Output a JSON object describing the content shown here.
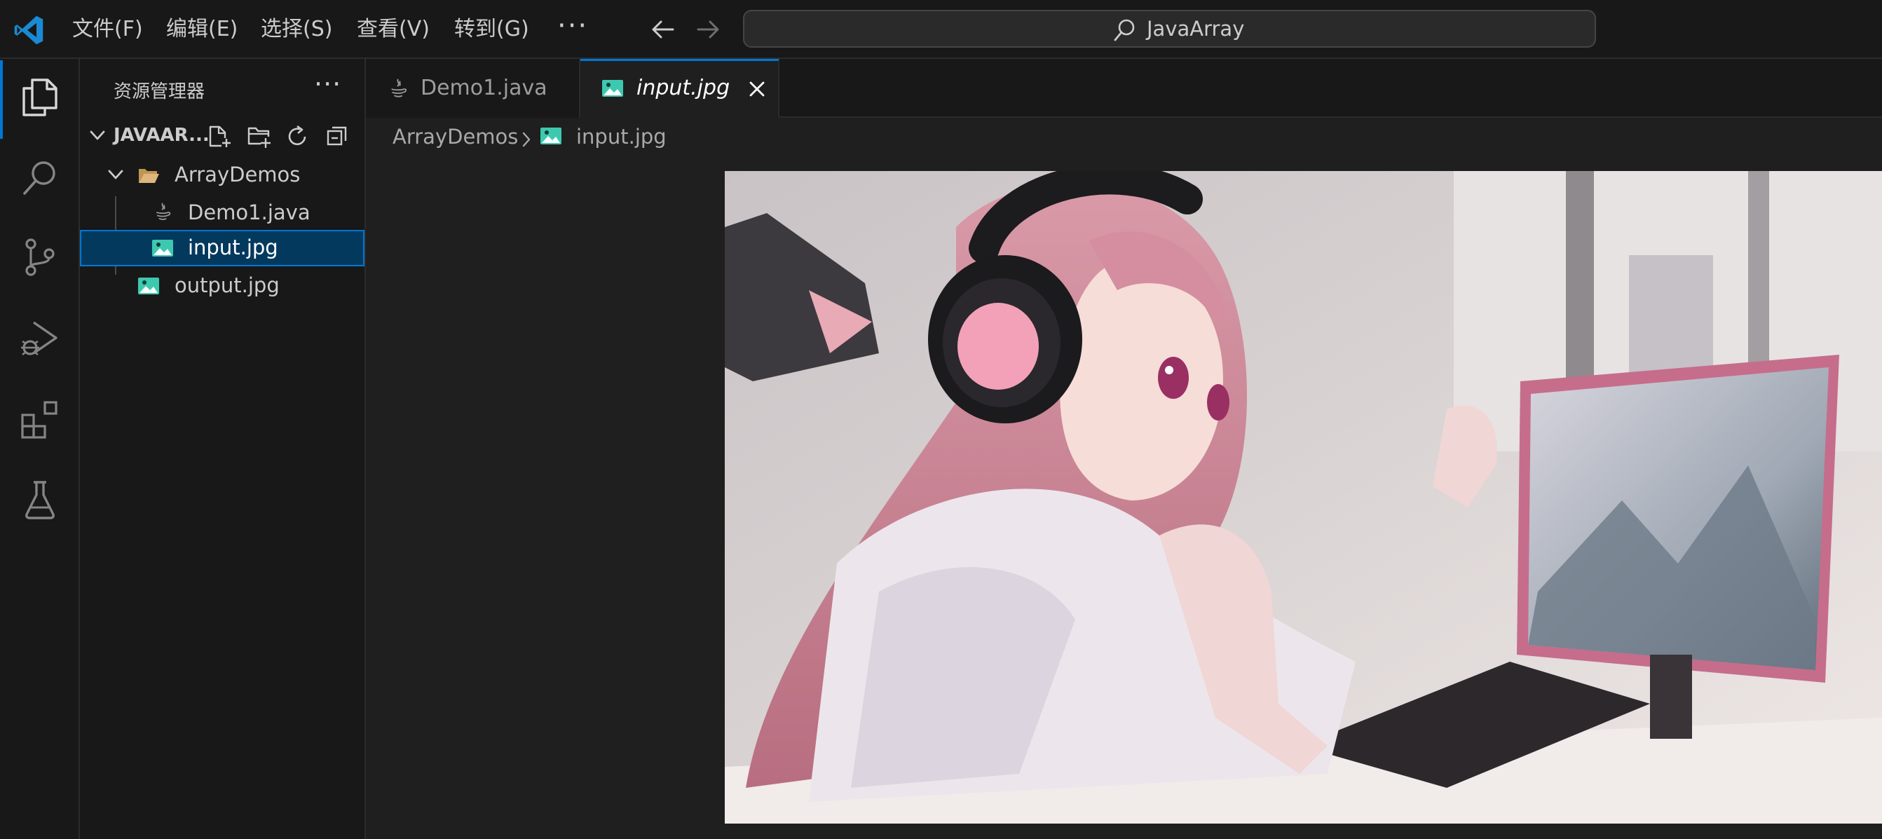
{
  "titlebar": {
    "menu": [
      "文件(F)",
      "编辑(E)",
      "选择(S)",
      "查看(V)",
      "转到(G)"
    ],
    "more": "···",
    "search_text": "JavaArray"
  },
  "sidebar": {
    "title": "资源管理器",
    "more": "···",
    "root_label": "JAVAAR...",
    "tree": [
      {
        "label": "ArrayDemos",
        "type": "folder",
        "expanded": true
      },
      {
        "label": "Demo1.java",
        "type": "java"
      },
      {
        "label": "input.jpg",
        "type": "image",
        "selected": true
      },
      {
        "label": "output.jpg",
        "type": "image"
      }
    ]
  },
  "editor": {
    "tabs": [
      {
        "label": "Demo1.java",
        "icon": "java-icon",
        "active": false
      },
      {
        "label": "input.jpg",
        "icon": "image-icon",
        "active": true
      }
    ],
    "breadcrumb": [
      "ArrayDemos",
      "input.jpg"
    ]
  },
  "colors": {
    "accent": "#0078d4",
    "selection": "#04395e",
    "image_icon": "#3dc9b0",
    "folder_icon": "#dcb67a"
  }
}
